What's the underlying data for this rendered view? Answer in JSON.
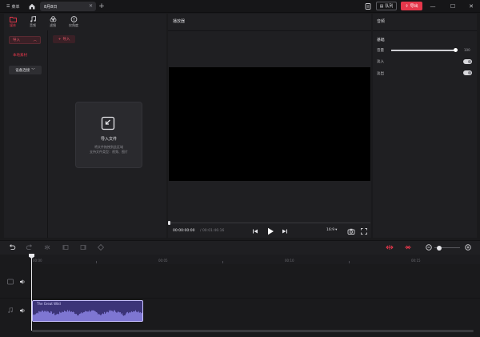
{
  "titlebar": {
    "menu_label": "菜单",
    "tab_title": "8月8日",
    "queue_label": "队列",
    "export_label": "导出"
  },
  "media": {
    "tabs": [
      {
        "label": "媒体",
        "icon": "folder-icon",
        "active": true
      },
      {
        "label": "音频",
        "icon": "music-note-icon",
        "active": false
      },
      {
        "label": "滤镜",
        "icon": "filter-icon",
        "active": false
      },
      {
        "label": "仅角度",
        "icon": "info-circle-icon",
        "active": false
      }
    ],
    "import_pill": "导入",
    "local_material": "本地素材",
    "device_button": "设备连接",
    "import_small": "导入",
    "dropzone": {
      "title": "导入文件",
      "line1": "将文件拖拽到此区域",
      "line2": "支持文件类型：视频、图片"
    }
  },
  "player": {
    "title": "播放器",
    "time_current": "00:00:00:00",
    "time_total": "/ 00:01:46:16",
    "aspect_ratio": "16:9",
    "progress": 0
  },
  "properties": {
    "title": "音频",
    "section": "基础",
    "volume_label": "音量",
    "volume_value": "100",
    "fade_in_label": "淡入",
    "fade_out_label": "淡出"
  },
  "timeline": {
    "ruler_labels": [
      "00:00",
      "00:05",
      "00:10",
      "00:15"
    ],
    "clip_title": "The Great Wild"
  },
  "colors": {
    "accent": "#e5374b",
    "clip": "#3c3478"
  }
}
